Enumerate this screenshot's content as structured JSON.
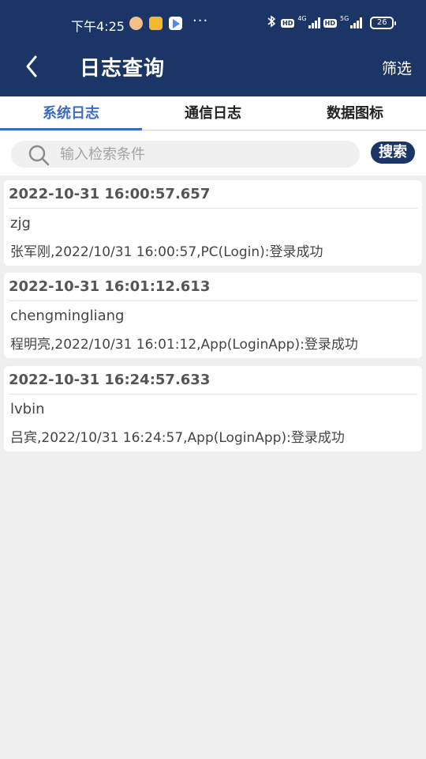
{
  "status_bar": {
    "time": "下午4:25",
    "more": "···",
    "hd1": "HD",
    "gen1": "4G",
    "hd2": "HD",
    "gen2": "5G",
    "battery": "26"
  },
  "header": {
    "title": "日志查询",
    "filter_label": "筛选"
  },
  "tabs": [
    {
      "label": "系统日志",
      "active": true
    },
    {
      "label": "通信日志",
      "active": false
    },
    {
      "label": "数据图标",
      "active": false
    }
  ],
  "search": {
    "placeholder": "输入检索条件",
    "value": "",
    "button_label": "搜索"
  },
  "logs": [
    {
      "time": "2022-10-31 16:00:57.657",
      "user": "zjg",
      "message": "张军刚,2022/10/31 16:00:57,PC(Login):登录成功"
    },
    {
      "time": "2022-10-31 16:01:12.613",
      "user": "chengmingliang",
      "message": "程明亮,2022/10/31 16:01:12,App(LoginApp):登录成功"
    },
    {
      "time": "2022-10-31 16:24:57.633",
      "user": "lvbin",
      "message": "吕宾,2022/10/31 16:24:57,App(LoginApp):登录成功"
    }
  ],
  "colors": {
    "header_bg": "#1b3566",
    "accent": "#3b6cc0",
    "background": "#efefef"
  }
}
